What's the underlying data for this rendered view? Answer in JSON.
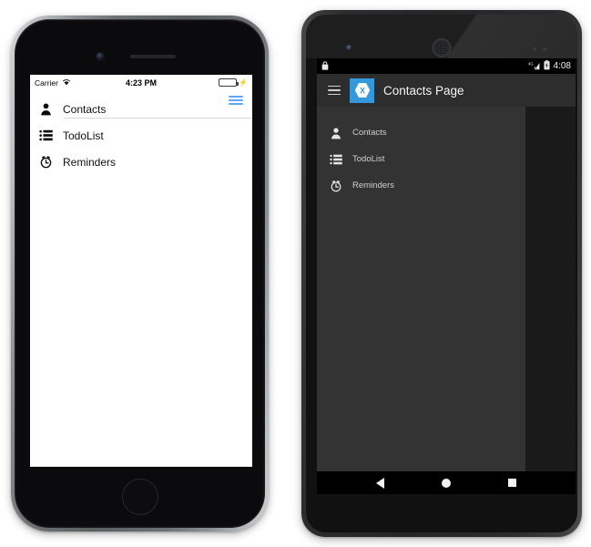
{
  "ios": {
    "statusbar": {
      "carrier": "Carrier",
      "wifi_icon": "wifi-icon",
      "time": "4:23 PM",
      "battery_icon": "battery-icon",
      "charging_icon": "charging-bolt-icon"
    },
    "menu_toggle_icon": "hamburger-menu-icon",
    "menu_items": [
      {
        "label": "Contacts",
        "icon": "person-icon"
      },
      {
        "label": "TodoList",
        "icon": "list-icon"
      },
      {
        "label": "Reminders",
        "icon": "alarm-clock-icon"
      }
    ]
  },
  "android": {
    "statusbar": {
      "lock_icon": "lock-icon",
      "signal_icon": "signal-4g-icon",
      "signal_label": "4G",
      "battery_icon": "battery-icon",
      "time": "4:08"
    },
    "appbar": {
      "menu_toggle_icon": "hamburger-menu-icon",
      "logo_icon": "xamarin-logo-icon",
      "logo_letter": "X",
      "title": "Contacts Page"
    },
    "menu_items": [
      {
        "label": "Contacts",
        "icon": "person-icon"
      },
      {
        "label": "TodoList",
        "icon": "list-icon"
      },
      {
        "label": "Reminders",
        "icon": "alarm-clock-icon"
      }
    ],
    "navbar": {
      "back_icon": "back-triangle-icon",
      "home_icon": "home-circle-icon",
      "recents_icon": "recents-square-icon"
    }
  },
  "colors": {
    "ios_accent": "#5ea9f5",
    "ios_battery": "#4cd763",
    "android_appbar": "#2d2d2d",
    "android_drawer": "#333333",
    "android_content": "#1a1a1a",
    "xamarin_blue": "#3498db"
  }
}
